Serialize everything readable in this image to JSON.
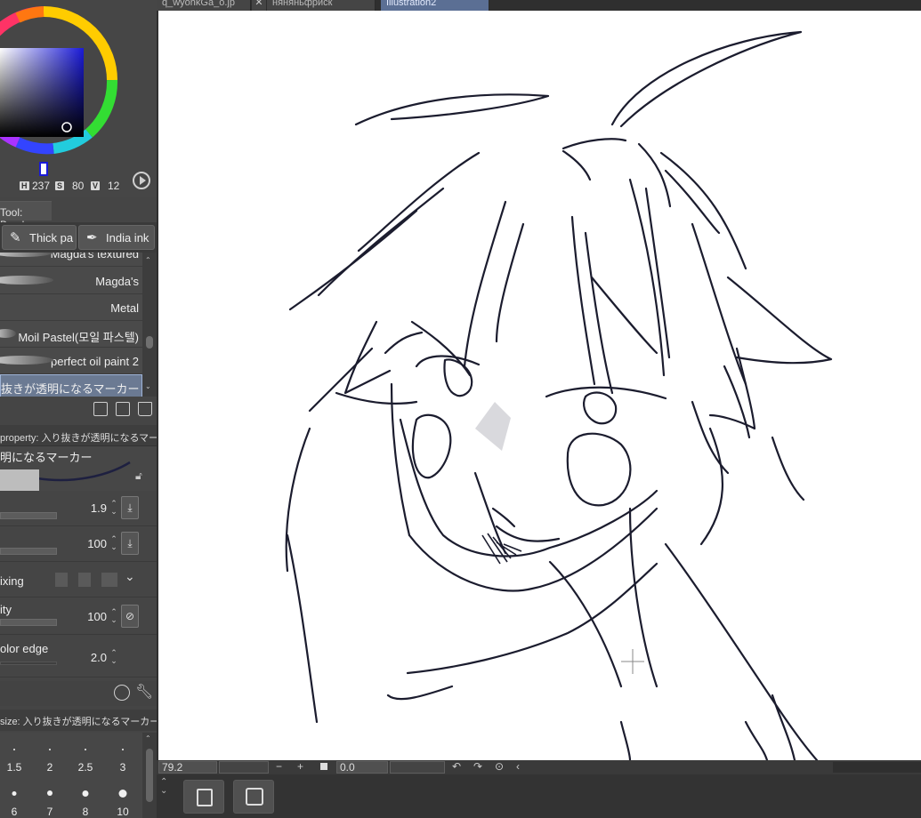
{
  "color": {
    "h_key": "H",
    "h": "237",
    "s_key": "S",
    "s": "80",
    "v_key": "V",
    "v": "12"
  },
  "tool_tab": "Tool: Brush",
  "subtools": [
    {
      "label": "Thick pa"
    },
    {
      "label": "India ink"
    }
  ],
  "brushes": [
    {
      "label": "Magda's textured"
    },
    {
      "label": "Magda's"
    },
    {
      "label": "Metal"
    },
    {
      "label": "Moil Pastel(모일 파스텔)"
    },
    {
      "label": "perfect oil paint 2"
    },
    {
      "label": "抜きが透明になるマーカー"
    }
  ],
  "property": {
    "header": "property: 入り抜きが透明になるマー",
    "preview_name": "明になるマーカー",
    "rows": [
      {
        "label": "",
        "value": "1.9"
      },
      {
        "label": "",
        "value": "100"
      },
      {
        "label": "ixing",
        "value": ""
      },
      {
        "label": "ity",
        "value": "100"
      },
      {
        "label": "olor edge",
        "value": "2.0"
      }
    ]
  },
  "size_header": "size: 入り抜きが透明になるマーカー",
  "sizes": [
    "1.5",
    "2",
    "2.5",
    "3",
    "6",
    "7",
    "8",
    "10"
  ],
  "tabs": [
    {
      "label": "q_wyohkGa_o.jp"
    },
    {
      "label": "няняньфриск"
    },
    {
      "label": "Illustration2"
    }
  ],
  "status": {
    "zoom": "79.2",
    "angle": "0.0"
  },
  "colors": {
    "panel": "#454545",
    "canvas": "#ffffff",
    "active_tab": "#5b6f94",
    "ink": "#1b1c2e"
  }
}
